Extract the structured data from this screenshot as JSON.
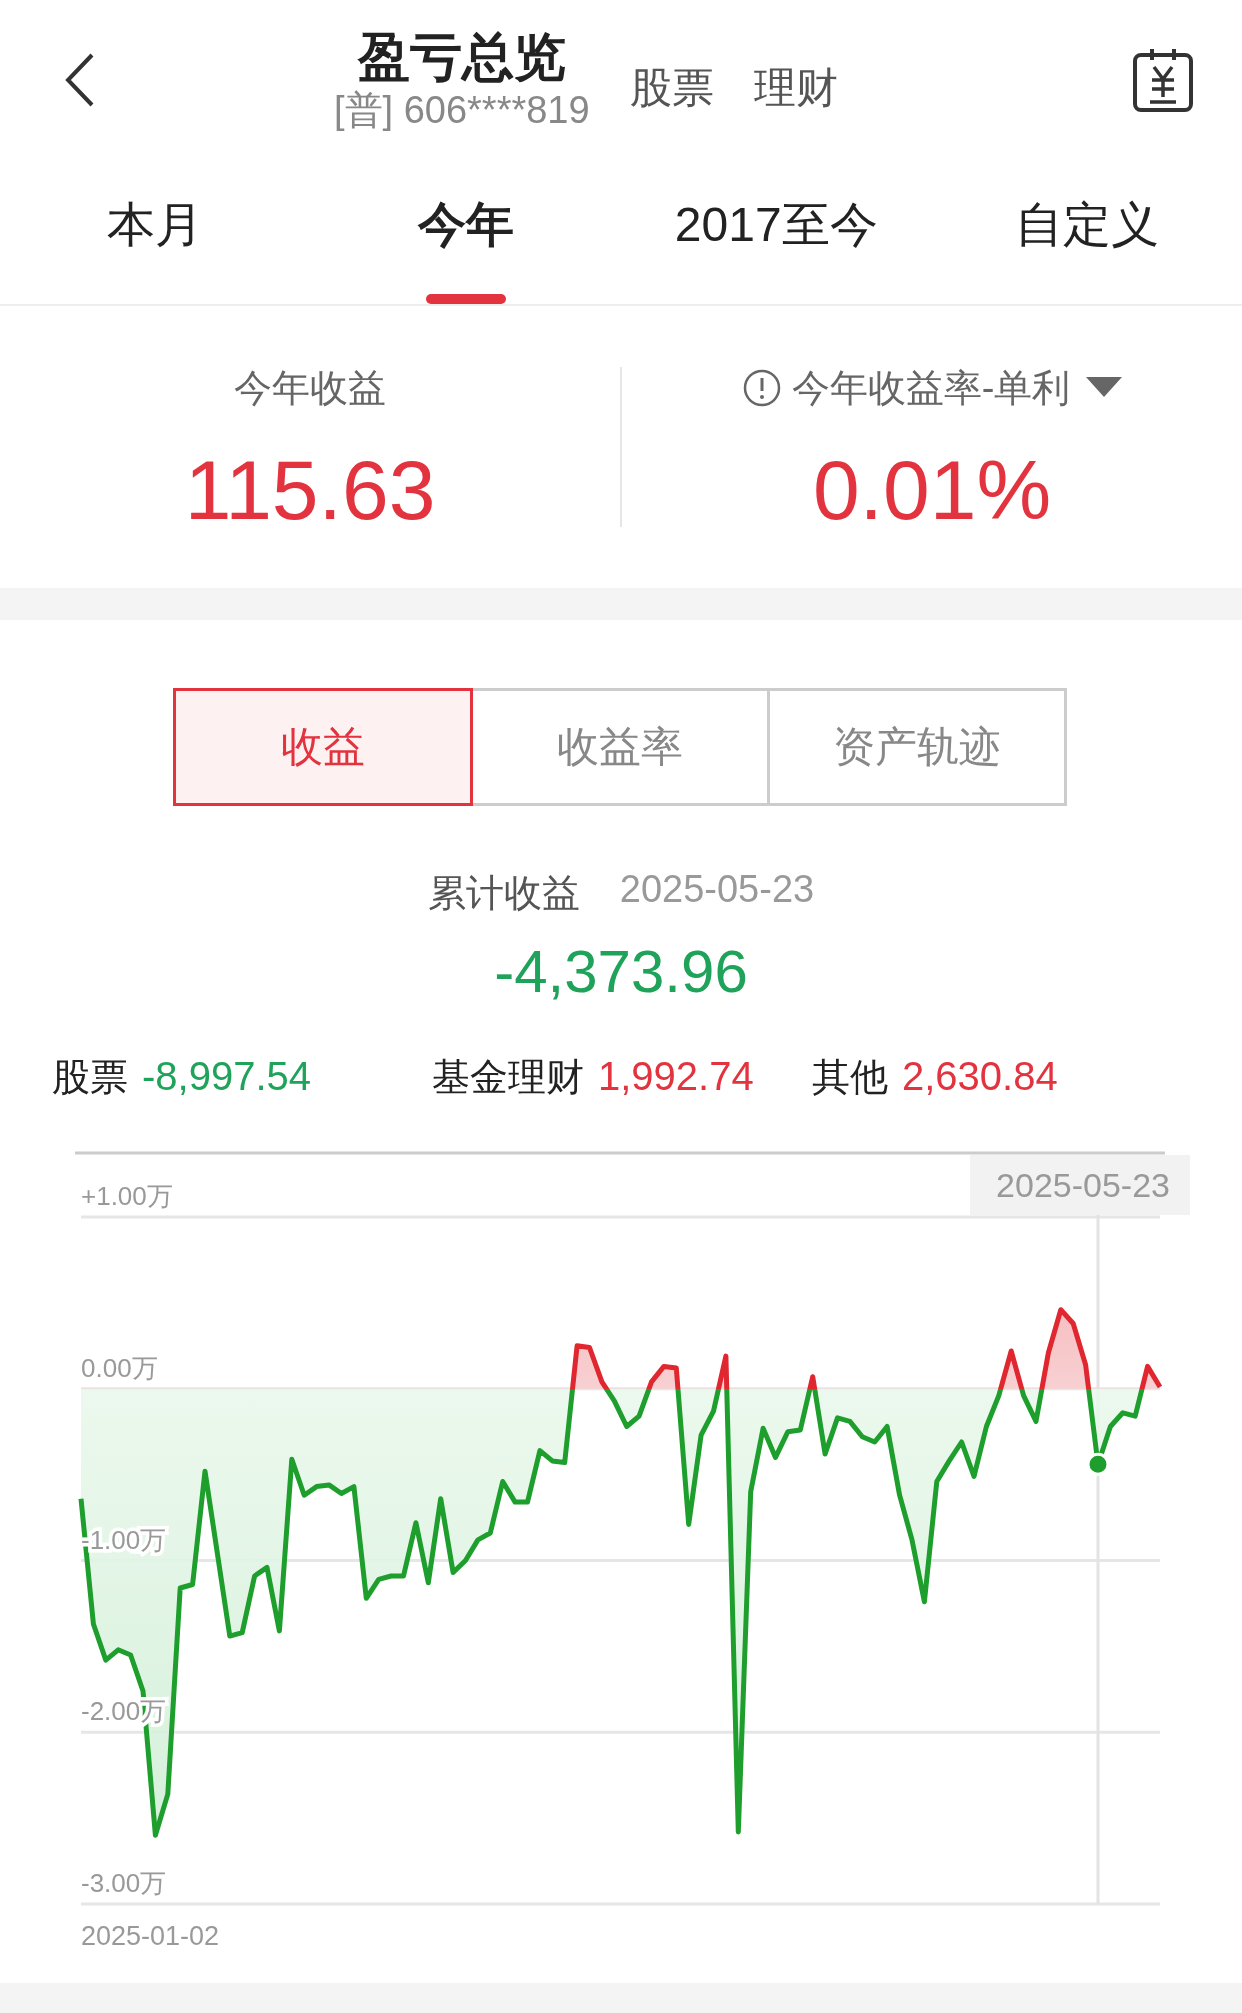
{
  "header": {
    "title": "盈亏总览",
    "account": "[普] 606****819",
    "links": [
      "股票",
      "理财"
    ]
  },
  "tabs": [
    {
      "label": "本月",
      "selected": false
    },
    {
      "label": "今年",
      "selected": true
    },
    {
      "label": "2017至今",
      "selected": false
    },
    {
      "label": "自定义",
      "selected": false
    }
  ],
  "summary": {
    "profit_label": "今年收益",
    "profit_value": "115.63",
    "rate_label": "今年收益率-单利",
    "rate_value": "0.01%"
  },
  "segments": [
    {
      "label": "收益",
      "selected": true
    },
    {
      "label": "收益率",
      "selected": false
    },
    {
      "label": "资产轨迹",
      "selected": false
    }
  ],
  "cumulative": {
    "label": "累计收益",
    "date": "2025-05-23",
    "value": "-4,373.96"
  },
  "breakdown": [
    {
      "label": "股票",
      "value": "-8,997.54",
      "color": "#1fa35a"
    },
    {
      "label": "基金理财",
      "value": "1,992.74",
      "color": "#e2333f"
    },
    {
      "label": "其他",
      "value": "2,630.84",
      "color": "#e2333f"
    }
  ],
  "chart": {
    "start_date": "2025-01-02",
    "chart_data": {
      "type": "area",
      "grid": true,
      "series": [
        {
          "color": "#1e9e2c",
          "values": [
            -0.64,
            -1.37,
            -1.58,
            -1.52,
            -1.55,
            -1.76,
            -2.6,
            -2.36,
            -1.16,
            -1.14,
            -0.48,
            -0.96,
            -1.44,
            -1.42,
            -1.09,
            -1.04,
            -1.41,
            -0.41,
            -0.62,
            -0.57,
            -0.56,
            -0.61,
            -0.57,
            -1.22,
            -1.11,
            -1.09,
            -1.09,
            -0.78,
            -1.13,
            -0.64,
            -1.07,
            -1.0,
            -0.88,
            -0.84,
            -0.54,
            -0.66,
            -0.66,
            -0.36,
            -0.42,
            -0.43,
            0.25,
            0.24,
            0.04,
            -0.07,
            -0.22,
            -0.16,
            0.04,
            0.13,
            0.12,
            -0.79,
            -0.27,
            -0.13,
            0.19,
            -2.58,
            -0.6,
            -0.23,
            -0.4,
            -0.25,
            -0.24,
            0.07,
            -0.38,
            -0.17,
            -0.19,
            -0.28,
            -0.31,
            -0.22,
            -0.62,
            -0.88,
            -1.24,
            -0.54,
            -0.42,
            -0.31,
            -0.51,
            -0.22,
            -0.04,
            0.22,
            -0.04,
            -0.19,
            0.21,
            0.46,
            0.38,
            0.14,
            -0.44,
            -0.22,
            -0.14,
            -0.16,
            0.13,
            0.01
          ]
        }
      ],
      "ylim": [
        -3,
        1
      ],
      "yticks": [
        {
          "value": 1,
          "label": "+1.00万"
        },
        {
          "value": 0,
          "label": "0.00万"
        },
        {
          "value": -1,
          "label": "-1.00万"
        },
        {
          "value": -2,
          "label": "-2.00万"
        },
        {
          "value": -3,
          "label": "-3.00万"
        }
      ],
      "annotations": [
        "2025-05-23"
      ]
    }
  }
}
